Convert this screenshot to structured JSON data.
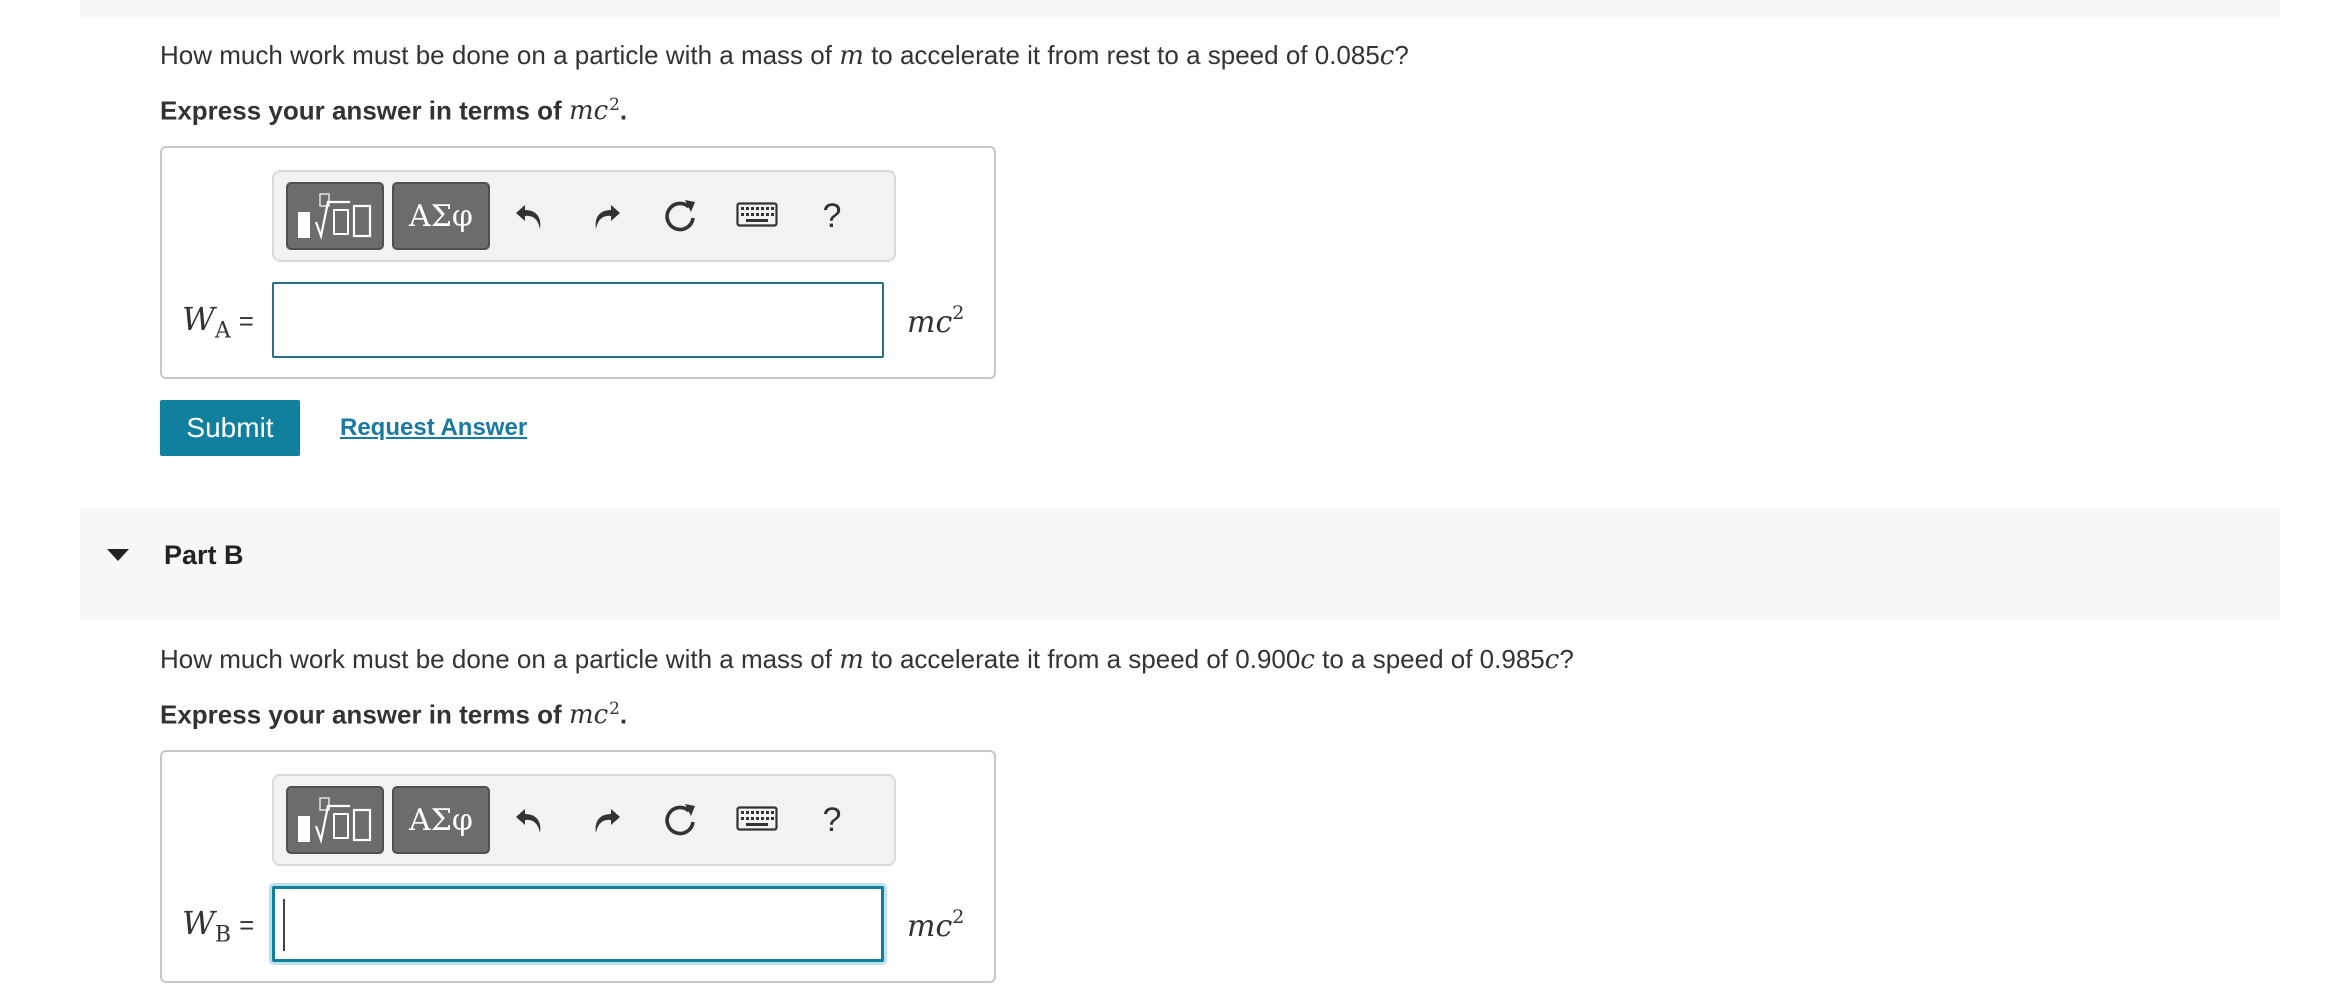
{
  "partA": {
    "question_pre": "How much work must be done on a particle with a mass of ",
    "question_var_m": "m",
    "question_post": " to accelerate it from rest to a speed of 0.085",
    "question_var_c": "c",
    "question_end": "?",
    "instruction_pre": "Express your answer in terms of ",
    "instruction_var": "mc",
    "instruction_exp": "2",
    "instruction_end": ".",
    "var_symbol": "W",
    "var_subscript": "A",
    "equals": "=",
    "input_value": "",
    "unit": "mc",
    "unit_exp": "2",
    "submit_label": "Submit",
    "request_label": "Request Answer"
  },
  "partB": {
    "header": "Part B",
    "question_pre": "How much work must be done on a particle with a mass of ",
    "question_var_m": "m",
    "question_mid": " to accelerate it from a speed of 0.900",
    "question_var_c1": "c",
    "question_post": " to a speed of 0.985",
    "question_var_c2": "c",
    "question_end": "?",
    "instruction_pre": "Express your answer in terms of ",
    "instruction_var": "mc",
    "instruction_exp": "2",
    "instruction_end": ".",
    "var_symbol": "W",
    "var_subscript": "B",
    "equals": "=",
    "input_value": "",
    "unit": "mc",
    "unit_exp": "2"
  },
  "toolbar": {
    "greek_label": "ΑΣφ",
    "help_label": "?",
    "icons": [
      "templates-icon",
      "greek-symbols-icon",
      "undo-icon",
      "redo-icon",
      "reset-icon",
      "keyboard-icon",
      "help-icon"
    ]
  },
  "colors": {
    "accent": "#10809e",
    "link": "#1a7aa0",
    "band": "#f7f7f7",
    "toolbar_button": "#6c6c6c"
  }
}
